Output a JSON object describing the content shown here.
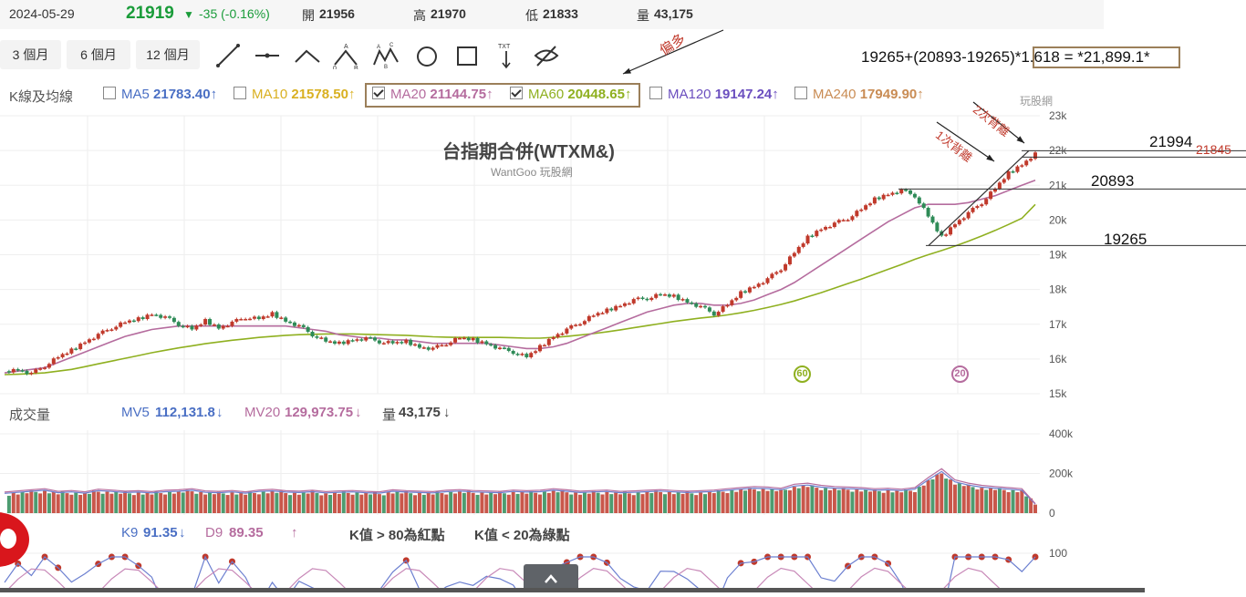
{
  "header": {
    "date": "2024-05-29",
    "price": "21919",
    "change": "-35 (-0.16%)",
    "open_label": "開",
    "open": "21956",
    "high_label": "高",
    "high": "21970",
    "low_label": "低",
    "low": "21833",
    "volume_label": "量",
    "volume": "43,175"
  },
  "toolbar": {
    "periods": [
      "3 個月",
      "6 個月",
      "12 個月"
    ],
    "tool_icons": [
      "trend-line-icon",
      "horizontal-line-icon",
      "angle-icon",
      "abc-pattern-icon",
      "abcd-pattern-icon",
      "circle-icon",
      "rectangle-icon",
      "text-icon",
      "hide-icon"
    ]
  },
  "ma_bar": {
    "label": "K線及均線",
    "items": [
      {
        "name": "MA5",
        "value": "21783.40",
        "arrow": "↑",
        "checked": false,
        "color": "#4a6fc4"
      },
      {
        "name": "MA10",
        "value": "21578.50",
        "arrow": "↑",
        "checked": false,
        "color": "#d9b021"
      },
      {
        "name": "MA20",
        "value": "21144.75",
        "arrow": "↑",
        "checked": true,
        "color": "#b56c9e"
      },
      {
        "name": "MA60",
        "value": "20448.65",
        "arrow": "↑",
        "checked": true,
        "color": "#8fb020"
      },
      {
        "name": "MA120",
        "value": "19147.24",
        "arrow": "↑",
        "checked": false,
        "color": "#6b4fbf"
      },
      {
        "name": "MA240",
        "value": "17949.90",
        "arrow": "↑",
        "checked": false,
        "color": "#c98c54"
      }
    ]
  },
  "annotations": {
    "bias_label": "偏多",
    "formula": "19265+(20893-19265)*1.618 = *21,899.1*",
    "first_div": "1次背離",
    "second_div": "2次背離",
    "level_high": "21994",
    "level_mid": "20893",
    "level_low": "19265",
    "level_side": "21845",
    "ma60_marker": "60",
    "ma20_marker": "20"
  },
  "chart_title": "台指期合併(WTXM&)",
  "chart_subtitle": "WantGoo 玩股網",
  "watermark": "玩股網",
  "volume_bar": {
    "label": "成交量",
    "mv5_label": "MV5",
    "mv5": "112,131.8",
    "mv5_arrow": "↓",
    "mv20_label": "MV20",
    "mv20": "129,973.75",
    "mv20_arrow": "↓",
    "vol_label": "量",
    "vol": "43,175",
    "vol_arrow": "↓"
  },
  "kd_bar": {
    "k_label": "K9",
    "k": "91.35",
    "k_arrow": "↓",
    "d_label": "D9",
    "d": "89.35",
    "d_arrow": "↑",
    "rule_red": "K值 > 80為紅點",
    "rule_green": "K值 < 20為綠點"
  },
  "colors": {
    "up": "#c0392b",
    "down": "#2e8b57",
    "ma20": "#b56c9e",
    "ma60": "#8fb020",
    "price_up": "#1a9c3a",
    "kd_k": "#6b7fd0",
    "kd_d": "#c889b8"
  },
  "chart_data": {
    "type": "line",
    "title": "台指期合併(WTXM&)",
    "price_axis": {
      "ticks": [
        "23k",
        "22k",
        "21k",
        "20k",
        "19k",
        "18k",
        "17k",
        "16k",
        "15k"
      ],
      "ylim": [
        15000,
        23000
      ]
    },
    "volume_axis": {
      "ticks": [
        "400k",
        "200k",
        "0"
      ],
      "ylim": [
        0,
        400000
      ]
    },
    "kd_axis": {
      "ticks": [
        "100"
      ]
    },
    "series": [
      {
        "name": "close",
        "values": [
          15650,
          15700,
          15580,
          15800,
          16050,
          16250,
          16500,
          16700,
          16900,
          17050,
          17150,
          17300,
          17200,
          17000,
          16850,
          17100,
          16900,
          17050,
          17200,
          17150,
          17300,
          17100,
          16950,
          16700,
          16500,
          16450,
          16550,
          16600,
          16500,
          16450,
          16500,
          16350,
          16300,
          16450,
          16600,
          16550,
          16450,
          16300,
          16200,
          16050,
          16350,
          16650,
          16850,
          17050,
          17250,
          17400,
          17550,
          17700,
          17750,
          17850,
          17800,
          17650,
          17500,
          17300,
          17550,
          17900,
          18100,
          18300,
          18600,
          19050,
          19500,
          19750,
          19900,
          20050,
          20300,
          20600,
          20750,
          20850,
          20700,
          20100,
          19500,
          19900,
          20200,
          20500,
          20900,
          21350,
          21600,
          21919
        ]
      },
      {
        "name": "MA20",
        "values": [
          15600,
          15650,
          15700,
          15750,
          15900,
          16050,
          16200,
          16350,
          16500,
          16650,
          16750,
          16850,
          16900,
          16950,
          16950,
          16950,
          16950,
          16950,
          16950,
          16950,
          16950,
          16950,
          16900,
          16850,
          16800,
          16700,
          16650,
          16600,
          16600,
          16550,
          16550,
          16500,
          16450,
          16450,
          16450,
          16450,
          16450,
          16400,
          16350,
          16300,
          16300,
          16350,
          16450,
          16600,
          16750,
          16900,
          17050,
          17200,
          17350,
          17450,
          17550,
          17600,
          17600,
          17550,
          17550,
          17600,
          17700,
          17850,
          18000,
          18200,
          18450,
          18700,
          18950,
          19200,
          19450,
          19700,
          19950,
          20150,
          20350,
          20450,
          20450,
          20450,
          20500,
          20600,
          20700,
          20850,
          21000,
          21144
        ]
      },
      {
        "name": "MA60",
        "values": [
          15550,
          15560,
          15580,
          15600,
          15650,
          15700,
          15780,
          15860,
          15940,
          16020,
          16100,
          16180,
          16250,
          16320,
          16380,
          16440,
          16490,
          16540,
          16580,
          16620,
          16650,
          16680,
          16700,
          16710,
          16720,
          16720,
          16720,
          16710,
          16700,
          16690,
          16680,
          16660,
          16640,
          16630,
          16620,
          16620,
          16620,
          16620,
          16610,
          16600,
          16600,
          16620,
          16650,
          16690,
          16730,
          16780,
          16840,
          16900,
          16960,
          17020,
          17080,
          17130,
          17180,
          17220,
          17270,
          17330,
          17400,
          17480,
          17570,
          17670,
          17790,
          17910,
          18040,
          18170,
          18300,
          18440,
          18580,
          18720,
          18870,
          19000,
          19120,
          19250,
          19390,
          19540,
          19700,
          19870,
          20050,
          20448
        ]
      },
      {
        "name": "volume",
        "values": [
          95000,
          100000,
          105000,
          110000,
          98000,
          102000,
          96000,
          108000,
          104000,
          99000,
          101000,
          97000,
          103000,
          105000,
          110000,
          100000,
          98000,
          102000,
          96000,
          104000,
          107000,
          101000,
          99000,
          103000,
          97000,
          100000,
          102000,
          98000,
          96000,
          105000,
          101000,
          99000,
          97000,
          103000,
          106000,
          102000,
          100000,
          98000,
          104000,
          101000,
          103000,
          110000,
          105000,
          99000,
          102000,
          104000,
          98000,
          100000,
          103000,
          106000,
          102000,
          99000,
          101000,
          104000,
          110000,
          115000,
          120000,
          118000,
          112000,
          130000,
          135000,
          125000,
          120000,
          118000,
          115000,
          110000,
          112000,
          108000,
          115000,
          160000,
          200000,
          150000,
          135000,
          125000,
          120000,
          115000,
          110000,
          43175
        ]
      }
    ],
    "annotations": [
      "1次背離",
      "2次背離"
    ],
    "levels": [
      21994,
      20893,
      19265
    ]
  }
}
